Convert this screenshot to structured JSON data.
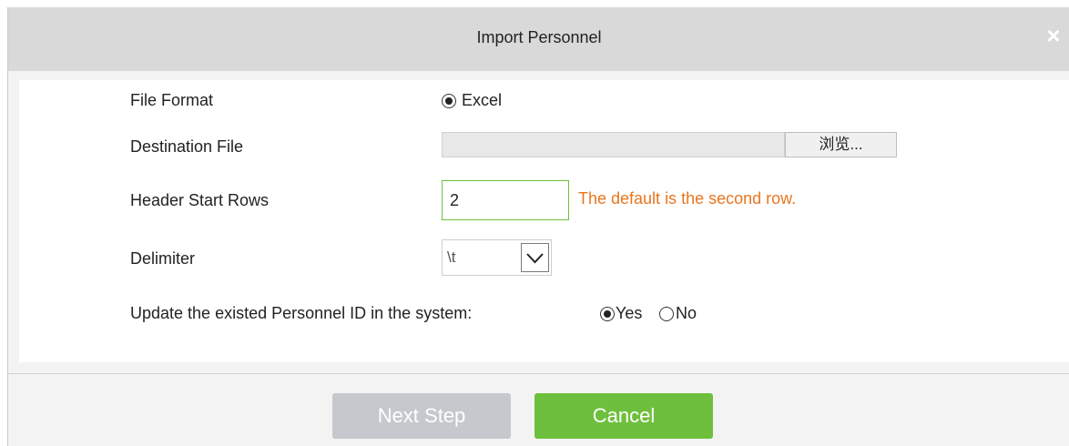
{
  "dialog": {
    "title": "Import Personnel",
    "close_symbol": "×"
  },
  "form": {
    "file_format": {
      "label": "File Format",
      "option_label": "Excel",
      "selected": true
    },
    "destination_file": {
      "label": "Destination File",
      "value": "",
      "browse_label": "浏览..."
    },
    "header_start_rows": {
      "label": "Header Start Rows",
      "value": "2",
      "hint": "The default is the second row."
    },
    "delimiter": {
      "label": "Delimiter",
      "selected": "\\t"
    },
    "update_existing": {
      "label": "Update the existed Personnel ID in the system:",
      "yes_label": "Yes",
      "no_label": "No",
      "selected": "Yes"
    }
  },
  "footer": {
    "next_label": "Next Step",
    "cancel_label": "Cancel"
  },
  "colors": {
    "hint": "#e8761f",
    "primary_button": "#6ebf3d",
    "disabled_button": "#c5c8cd",
    "titlebar": "#d9d9d9"
  },
  "icons": {
    "close": "close-icon",
    "dropdown": "chevron-down-icon"
  }
}
